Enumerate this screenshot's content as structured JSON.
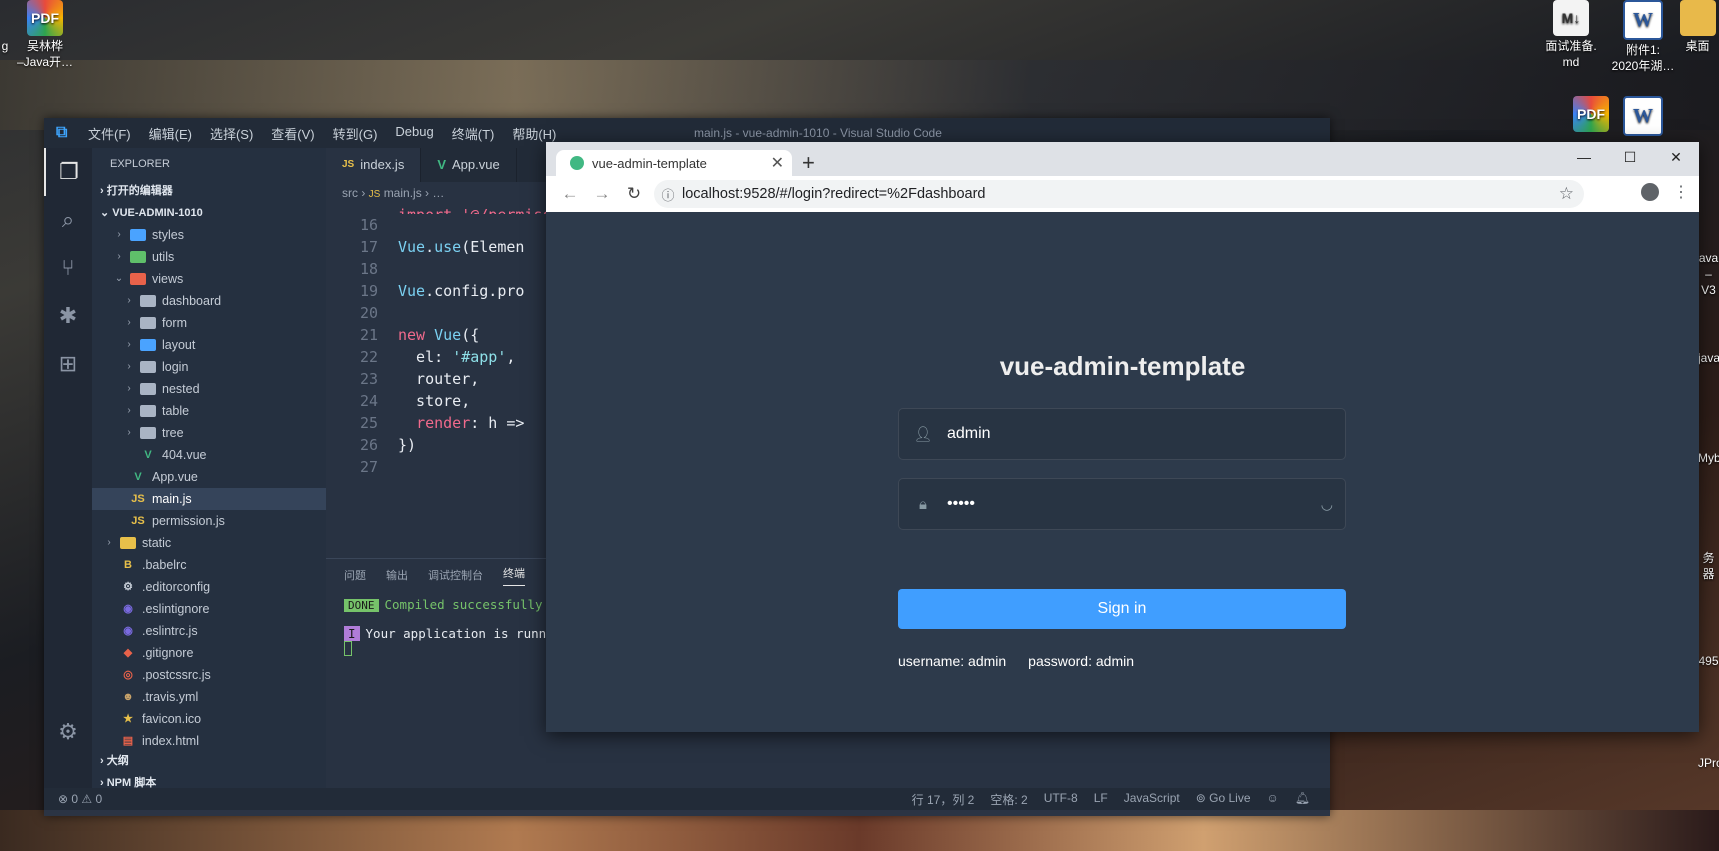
{
  "desktop": {
    "icons_left": [
      {
        "label_1": "吴林桦",
        "label_2": "–Java开…",
        "icon": "pdf-icon"
      }
    ],
    "icons_left_edge_label": "g",
    "icons_right": [
      {
        "label_1": "面试准备.",
        "label_2": "md",
        "icon": "markdown-icon"
      },
      {
        "label_1": "附件1:",
        "label_2": "2020年湖…",
        "icon": "word-icon"
      },
      {
        "label_1": "桌面",
        "label_2": "",
        "icon": "folder-icon"
      }
    ],
    "icons_right_edge": [
      "ava",
      "–V3",
      "java",
      "Myb",
      "务器",
      "495",
      "JPro"
    ]
  },
  "vscode": {
    "window_title": "main.js - vue-admin-1010 - Visual Studio Code",
    "menu": [
      "文件(F)",
      "编辑(E)",
      "选择(S)",
      "查看(V)",
      "转到(G)",
      "Debug",
      "终端(T)",
      "帮助(H)"
    ],
    "explorer_label": "EXPLORER",
    "open_editors": "打开的编辑器",
    "project": "VUE-ADMIN-1010",
    "tree": [
      {
        "name": "styles",
        "type": "folder",
        "color": "blue",
        "depth": 2,
        "open": false
      },
      {
        "name": "utils",
        "type": "folder",
        "color": "green",
        "depth": 2,
        "open": false
      },
      {
        "name": "views",
        "type": "folder",
        "color": "red",
        "depth": 2,
        "open": true
      },
      {
        "name": "dashboard",
        "type": "folder",
        "depth": 3,
        "open": false
      },
      {
        "name": "form",
        "type": "folder",
        "depth": 3,
        "open": false
      },
      {
        "name": "layout",
        "type": "folder",
        "color": "blue",
        "depth": 3,
        "open": false
      },
      {
        "name": "login",
        "type": "folder",
        "depth": 3,
        "open": false
      },
      {
        "name": "nested",
        "type": "folder",
        "depth": 3,
        "open": false
      },
      {
        "name": "table",
        "type": "folder",
        "depth": 3,
        "open": false
      },
      {
        "name": "tree",
        "type": "folder",
        "depth": 3,
        "open": false
      },
      {
        "name": "404.vue",
        "type": "vue",
        "depth": 3
      },
      {
        "name": "App.vue",
        "type": "vue",
        "depth": 2
      },
      {
        "name": "main.js",
        "type": "js",
        "depth": 2,
        "selected": true
      },
      {
        "name": "permission.js",
        "type": "js",
        "depth": 2
      },
      {
        "name": "static",
        "type": "folder",
        "color": "yellow",
        "depth": 1,
        "open": false
      },
      {
        "name": ".babelrc",
        "type": "babel",
        "depth": 1
      },
      {
        "name": ".editorconfig",
        "type": "cfg",
        "depth": 1
      },
      {
        "name": ".eslintignore",
        "type": "eslint",
        "depth": 1
      },
      {
        "name": ".eslintrc.js",
        "type": "eslint",
        "depth": 1
      },
      {
        "name": ".gitignore",
        "type": "git",
        "depth": 1
      },
      {
        "name": ".postcssrc.js",
        "type": "postcss",
        "depth": 1
      },
      {
        "name": ".travis.yml",
        "type": "travis",
        "depth": 1
      },
      {
        "name": "favicon.ico",
        "type": "star",
        "depth": 1
      },
      {
        "name": "index.html",
        "type": "html",
        "depth": 1
      }
    ],
    "outline": "大纲",
    "npm": "NPM 脚本",
    "tabs": [
      {
        "label": "index.js",
        "icon": "JS"
      },
      {
        "label": "App.vue",
        "icon": "V"
      }
    ],
    "breadcrumb_src": "src",
    "breadcrumb_file": "main.js",
    "breadcrumb_more": "…",
    "code_first_line": "import '@/permission'",
    "code_lines": [
      {
        "n": "16",
        "html": ""
      },
      {
        "n": "17",
        "html": "<span class='fn'>Vue</span>.<span class='prop'>use</span>(Elemen"
      },
      {
        "n": "18",
        "html": ""
      },
      {
        "n": "19",
        "html": "<span class='fn'>Vue</span>.config.pro"
      },
      {
        "n": "20",
        "html": ""
      },
      {
        "n": "21",
        "html": "<span class='kw'>new</span> <span class='fn'>Vue</span>({"
      },
      {
        "n": "22",
        "html": "  el: <span class='str'>'#app'</span>,"
      },
      {
        "n": "23",
        "html": "  router,"
      },
      {
        "n": "24",
        "html": "  store,"
      },
      {
        "n": "25",
        "html": "  <span class='kw'>render</span>: h =>"
      },
      {
        "n": "26",
        "html": "})"
      },
      {
        "n": "27",
        "html": ""
      }
    ],
    "panel_tabs": [
      "问题",
      "输出",
      "调试控制台",
      "终端"
    ],
    "term_done": "DONE",
    "term_line1": "Compiled successfully",
    "term_i": "I",
    "term_line2": "Your application is runni",
    "status_left": "⊗ 0 ⚠ 0",
    "status_right": [
      "行 17，列 2",
      "空格: 2",
      "UTF-8",
      "LF",
      "JavaScript",
      "Go Live"
    ]
  },
  "chrome": {
    "tab_title": "vue-admin-template",
    "url": "localhost:9528/#/login?redirect=%2Fdashboard",
    "login_title": "vue-admin-template",
    "username_value": "admin",
    "password_value": "•••••",
    "signin_label": "Sign in",
    "tip_username": "username: admin",
    "tip_password": "password: admin"
  }
}
